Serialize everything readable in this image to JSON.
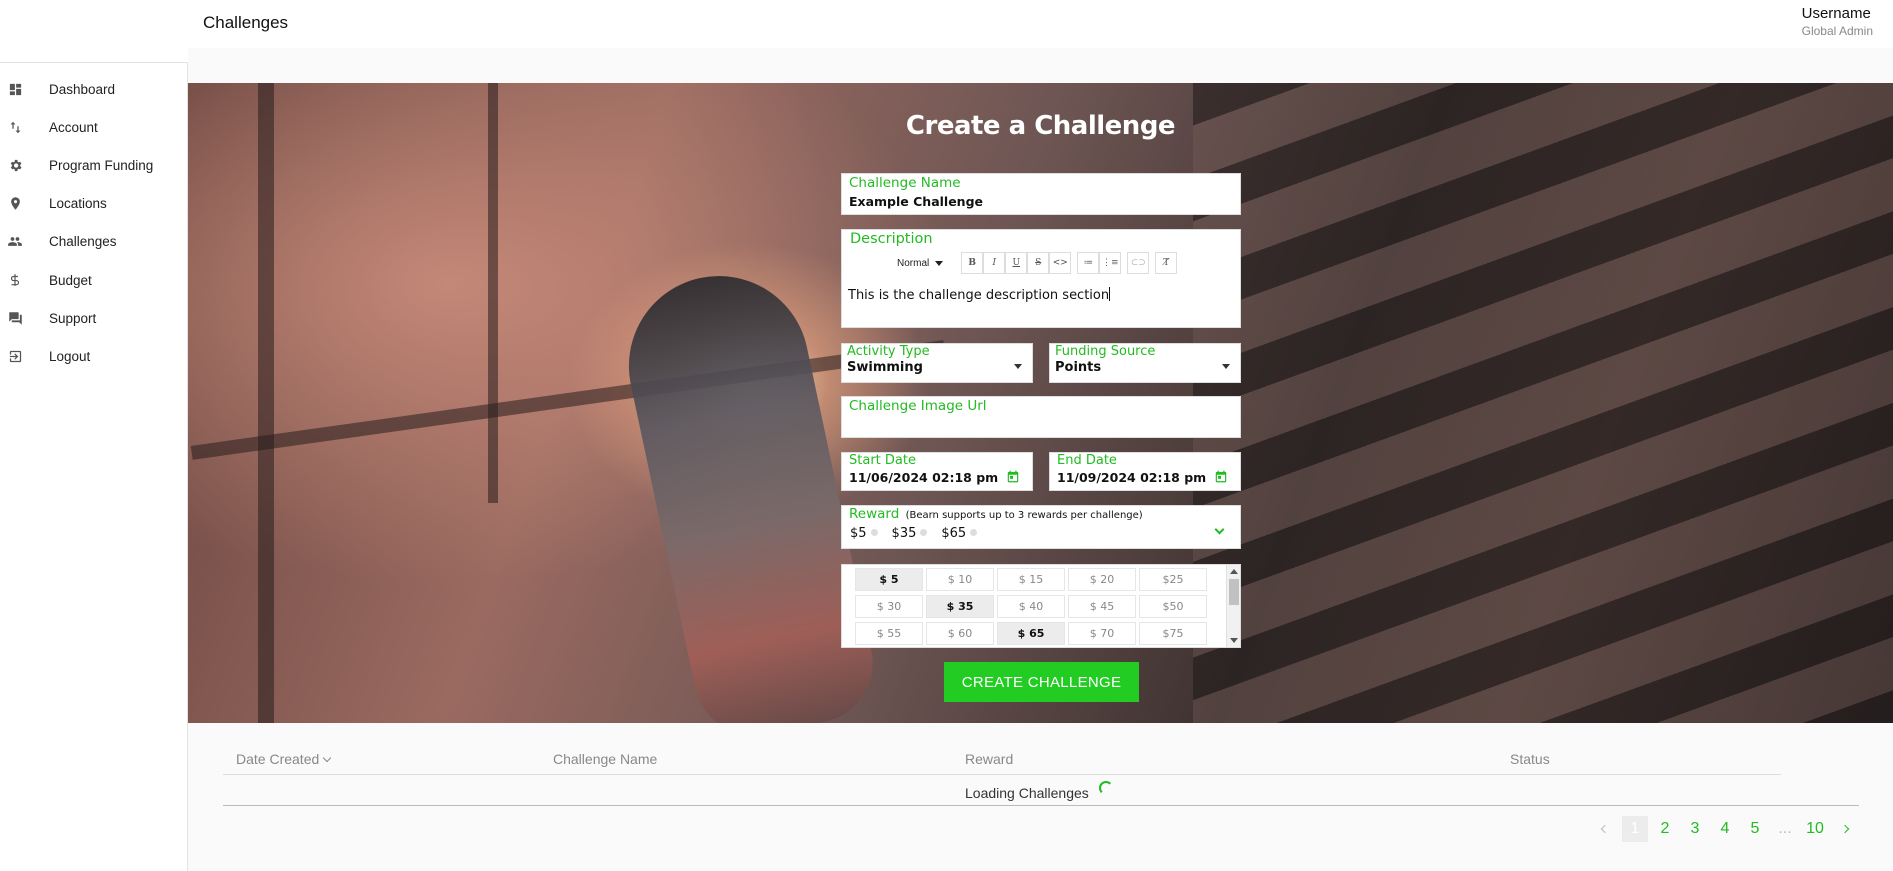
{
  "header": {
    "title": "Challenges",
    "username": "Username",
    "role": "Global Admin"
  },
  "sidebar": {
    "items": [
      {
        "label": "Dashboard",
        "icon": "dashboard-icon"
      },
      {
        "label": "Account",
        "icon": "transfer-icon"
      },
      {
        "label": "Program Funding",
        "icon": "gear-icon"
      },
      {
        "label": "Locations",
        "icon": "location-pin-icon"
      },
      {
        "label": "Challenges",
        "icon": "people-icon"
      },
      {
        "label": "Budget",
        "icon": "dollar-icon"
      },
      {
        "label": "Support",
        "icon": "chat-icon"
      },
      {
        "label": "Logout",
        "icon": "logout-icon"
      }
    ]
  },
  "form": {
    "title": "Create a Challenge",
    "challenge_name": {
      "label": "Challenge Name",
      "value": "Example Challenge"
    },
    "description": {
      "label": "Description",
      "toolbar": {
        "format": "Normal",
        "buttons": [
          {
            "name": "bold",
            "glyph": "B"
          },
          {
            "name": "italic",
            "glyph": "I"
          },
          {
            "name": "underline",
            "glyph": "U"
          },
          {
            "name": "strikethrough",
            "glyph": "S"
          },
          {
            "name": "code",
            "glyph": "<>"
          },
          {
            "name": "bullet-list",
            "glyph": "≔"
          },
          {
            "name": "ordered-list",
            "glyph": "⋮≡"
          },
          {
            "name": "link",
            "glyph": "⊂⊃"
          },
          {
            "name": "clear-format",
            "glyph": "T̸"
          }
        ]
      },
      "value": "This is the challenge description section"
    },
    "activity_type": {
      "label": "Activity Type",
      "value": "Swimming"
    },
    "funding_source": {
      "label": "Funding Source",
      "value": "Points"
    },
    "image_url": {
      "label": "Challenge Image Url",
      "value": ""
    },
    "start_date": {
      "label": "Start Date",
      "value": "11/06/2024 02:18 pm"
    },
    "end_date": {
      "label": "End Date",
      "value": "11/09/2024 02:18 pm"
    },
    "reward": {
      "label": "Reward",
      "note": "(Bearn supports up to 3 rewards per challenge)",
      "selected": [
        "$5",
        "$35",
        "$65"
      ],
      "options": [
        {
          "label": "$ 5",
          "selected": true
        },
        {
          "label": "$ 10",
          "selected": false
        },
        {
          "label": "$ 15",
          "selected": false
        },
        {
          "label": "$ 20",
          "selected": false
        },
        {
          "label": "$25",
          "selected": false
        },
        {
          "label": "$ 30",
          "selected": false
        },
        {
          "label": "$ 35",
          "selected": true
        },
        {
          "label": "$ 40",
          "selected": false
        },
        {
          "label": "$ 45",
          "selected": false
        },
        {
          "label": "$50",
          "selected": false
        },
        {
          "label": "$ 55",
          "selected": false
        },
        {
          "label": "$ 60",
          "selected": false
        },
        {
          "label": "$ 65",
          "selected": true
        },
        {
          "label": "$ 70",
          "selected": false
        },
        {
          "label": "$75",
          "selected": false
        }
      ]
    },
    "submit_label": "CREATE CHALLENGE"
  },
  "table": {
    "columns": [
      "Date Created",
      "Challenge Name",
      "Reward",
      "Status"
    ],
    "loading_text": "Loading Challenges"
  },
  "pagination": {
    "pages": [
      "1",
      "2",
      "3",
      "4",
      "5"
    ],
    "ellipsis": "...",
    "last": "10",
    "current": "1"
  },
  "colors": {
    "accent": "#22cc22",
    "label_green": "#22bb22",
    "muted": "#888888"
  }
}
